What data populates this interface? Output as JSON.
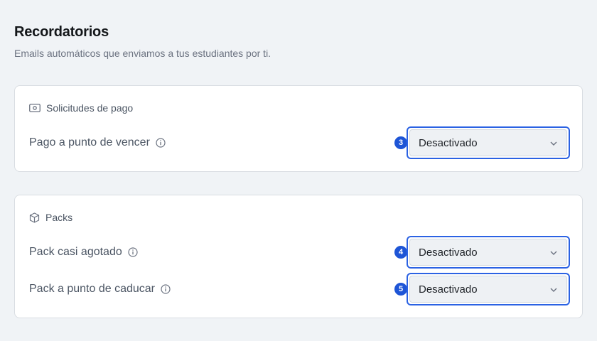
{
  "header": {
    "title": "Recordatorios",
    "subtitle": "Emails automáticos que enviamos a tus estudiantes por ti."
  },
  "sections": [
    {
      "title": "Solicitudes de pago",
      "icon": "money-icon",
      "rows": [
        {
          "label": "Pago a punto de vencer",
          "badge": "3",
          "value": "Desactivado"
        }
      ]
    },
    {
      "title": "Packs",
      "icon": "box-icon",
      "rows": [
        {
          "label": "Pack casi agotado",
          "badge": "4",
          "value": "Desactivado"
        },
        {
          "label": "Pack a punto de caducar",
          "badge": "5",
          "value": "Desactivado"
        }
      ]
    }
  ],
  "colors": {
    "accent": "#2b62e3",
    "badge": "#1e55d6",
    "background": "#f0f3f6"
  }
}
